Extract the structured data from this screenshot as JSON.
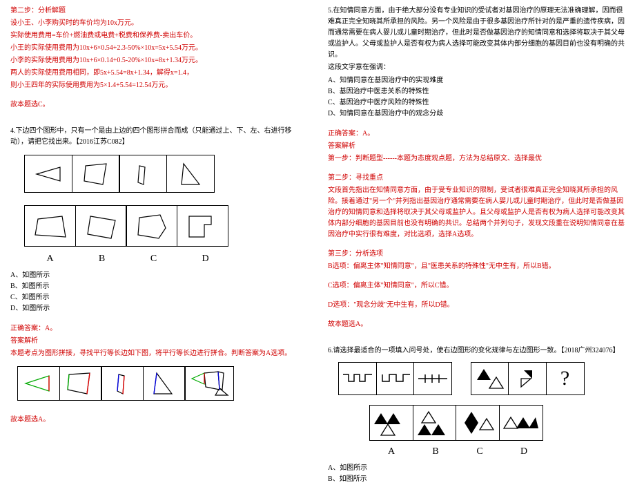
{
  "left": {
    "step2_title": "第二步：分析解题",
    "l1": "设小王、小李购买时的车价均为10x万元。",
    "l2": "实际使用费用=车价+燃油费或电费+税费和保养费-卖出车价。",
    "l3": "小王的实际使用费用为10x+6×0.54+2.3-50%×10x=5x+5.54万元。",
    "l4": "小李的实际使用费用为10x+6×0.14+0.5-20%×10x=8x+1.34万元。",
    "l5": "两人的实际使用费用相同，即5x+5.54=8x+1.34，解得x=1.4，",
    "l6": "则小王四年的实际使用费用为5×1.4+5.54=12.54万元。",
    "ans1": "故本题选C。",
    "q4": "4.下边四个图形中，只有一个是由上边的四个图形拼合而成（只能通过上、下、左、右进行移动），请把它找出来。【2016江苏C082】",
    "optA": "A、如图所示",
    "optB": "B、如图所示",
    "optC": "C、如图所示",
    "optD": "D、如图所示",
    "correct": "正确答案：A。",
    "exp_title": "答案解析",
    "exp": "本题考点为图形拼接，寻找平行等长边如下图，将平行等长边进行拼合。判断答案为A选项。",
    "ans2": "故本题选A。",
    "A": "A",
    "B": "B",
    "C": "C",
    "D": "D"
  },
  "right": {
    "q5": "5.在知情同意方面，由于绝大部分没有专业知识的受试者对基因治疗的原理无法准确理解，因而很难真正完全知晓其所承担的风险。另一个风险是由于很多基因治疗所针对的是严重的遗传疾病，因而通常需要在病人婴儿或儿童时期治疗，但此时是否做基因治疗的知情同意和选择将取决于其父母或监护人。父母或监护人是否有权为病人选择可能改变其体内部分细胞的基因目前也没有明确的共识。",
    "q5b": "这段文字意在强调：",
    "q5A": "A、知情同意在基因治疗中的实现难度",
    "q5B": "B、基因治疗中医患关系的特殊性",
    "q5C": "C、基因治疗中医疗风险的特殊性",
    "q5D": "D、知情同意在基因治疗中的观念分歧",
    "correct5": "正确答案：A。",
    "exp5_title": "答案解析",
    "s1": "第一步：判断题型------本题为态度观点题，方法为总结原文、选择最优",
    "s2": "第二步：寻找重点",
    "s2t": "文段首先指出在知情同意方面，由于受专业知识的限制，受试者很难真正完全知晓其所承担的风险。接着通过\"另一个\"并列指出基因治疗通常需要在病人婴儿或儿童时期治疗，但此时是否做基因治疗的知情同意和选择将取决于其父母或监护人。且父母或监护人是否有权为病人选择可能改变其体内部分细胞的基因目前也没有明确的共识。总结两个并列句子，发现文段重在说明知情同意在基因治疗中实行很有难度，对比选项，选择A选项。",
    "s3": "第三步：分析选项",
    "s3b": "B选项：偏离主体\"知情同意\"，且\"医患关系的特殊性\"无中生有，所以B错。",
    "s3c": "C选项：偏离主体\"知情同意\"，所以C错。",
    "s3d": "D选项：\"观念分歧\"无中生有，所以D错。",
    "ans5": "故本题选A。",
    "q6": "6.请选择最适合的一项填入问号处，使右边图形的变化规律与左边图形一致。【2018广州324076】",
    "q6A": "A、如图所示",
    "q6B": "B、如图所示",
    "A": "A",
    "B": "B",
    "C": "C",
    "D": "D",
    "qmark": "?"
  }
}
